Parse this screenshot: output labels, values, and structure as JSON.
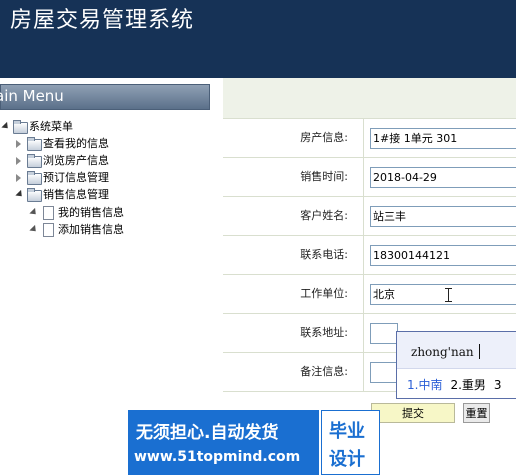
{
  "header": {
    "title": "房屋交易管理系统"
  },
  "sidebar": {
    "title": "ain Menu",
    "tree": {
      "root": "系统菜单",
      "items": [
        "查看我的信息",
        "浏览房产信息",
        "预订信息管理",
        "销售信息管理"
      ],
      "children": [
        "我的销售信息",
        "添加销售信息"
      ]
    }
  },
  "form": {
    "rows": [
      {
        "label": "房产信息:",
        "value": "1#接 1单元 301"
      },
      {
        "label": "销售时间:",
        "value": "2018-04-29"
      },
      {
        "label": "客户姓名:",
        "value": "站三丰"
      },
      {
        "label": "联系电话:",
        "value": "18300144121"
      },
      {
        "label": "工作单位:",
        "value": "北京"
      },
      {
        "label": "联系地址:",
        "value": ""
      },
      {
        "label": "备注信息:",
        "value": ""
      }
    ],
    "submit_label": "提交",
    "reset_label": "重置"
  },
  "ime": {
    "pinyin": "zhong'nan",
    "candidates": [
      "1.中南",
      "2.重男",
      "3"
    ]
  },
  "watermark": {
    "line1": "无须担心.自动发货",
    "line2": "www.51topmind.com",
    "right1": "毕业",
    "right2": "设计"
  }
}
